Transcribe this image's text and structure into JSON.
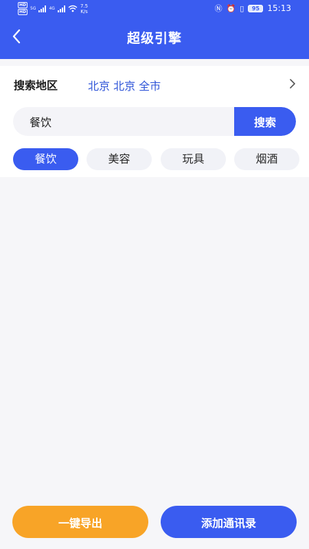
{
  "status_bar": {
    "network_labels": [
      "HD",
      "HD"
    ],
    "sim1": "5G",
    "sim2": "4G",
    "speed_value": "7.5",
    "speed_unit": "K/s",
    "battery": "95",
    "time": "15:13"
  },
  "header": {
    "title": "超级引擎",
    "background": "#3a5cf0"
  },
  "region": {
    "label": "搜索地区",
    "value": "北京 北京 全市"
  },
  "search": {
    "value": "餐饮",
    "placeholder": "",
    "button_label": "搜索"
  },
  "categories": [
    {
      "label": "餐饮",
      "active": true
    },
    {
      "label": "美容",
      "active": false
    },
    {
      "label": "玩具",
      "active": false
    },
    {
      "label": "烟酒",
      "active": false
    }
  ],
  "footer": {
    "export_label": "一键导出",
    "add_contacts_label": "添加通讯录",
    "export_color": "#f8a427",
    "add_color": "#3a5cf0"
  }
}
